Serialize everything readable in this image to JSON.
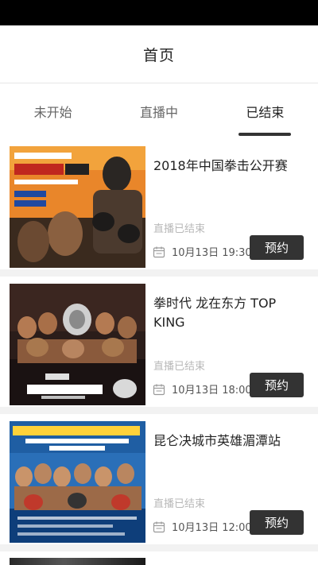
{
  "header": {
    "title": "首页"
  },
  "tabs": [
    {
      "label": "未开始",
      "active": false
    },
    {
      "label": "直播中",
      "active": false
    },
    {
      "label": "已结束",
      "active": true
    }
  ],
  "events": [
    {
      "title": "2018年中国拳击公开赛",
      "status": "直播已结束",
      "time": "10月13日 19:30",
      "button": "预约",
      "poster_icon": "boxing-event-poster-orange"
    },
    {
      "title": "拳时代 龙在东方 TOP KING",
      "status": "直播已结束",
      "time": "10月13日 18:00",
      "button": "预约",
      "poster_icon": "topking-event-poster-dark"
    },
    {
      "title": "昆仑决城市英雄湄潭站",
      "status": "直播已结束",
      "time": "10月13日 12:00",
      "button": "预约",
      "poster_icon": "kunlun-event-poster-blue"
    }
  ],
  "colors": {
    "accent": "#333333",
    "status_text": "#b8b8b8",
    "tab_indicator": "#333333"
  }
}
